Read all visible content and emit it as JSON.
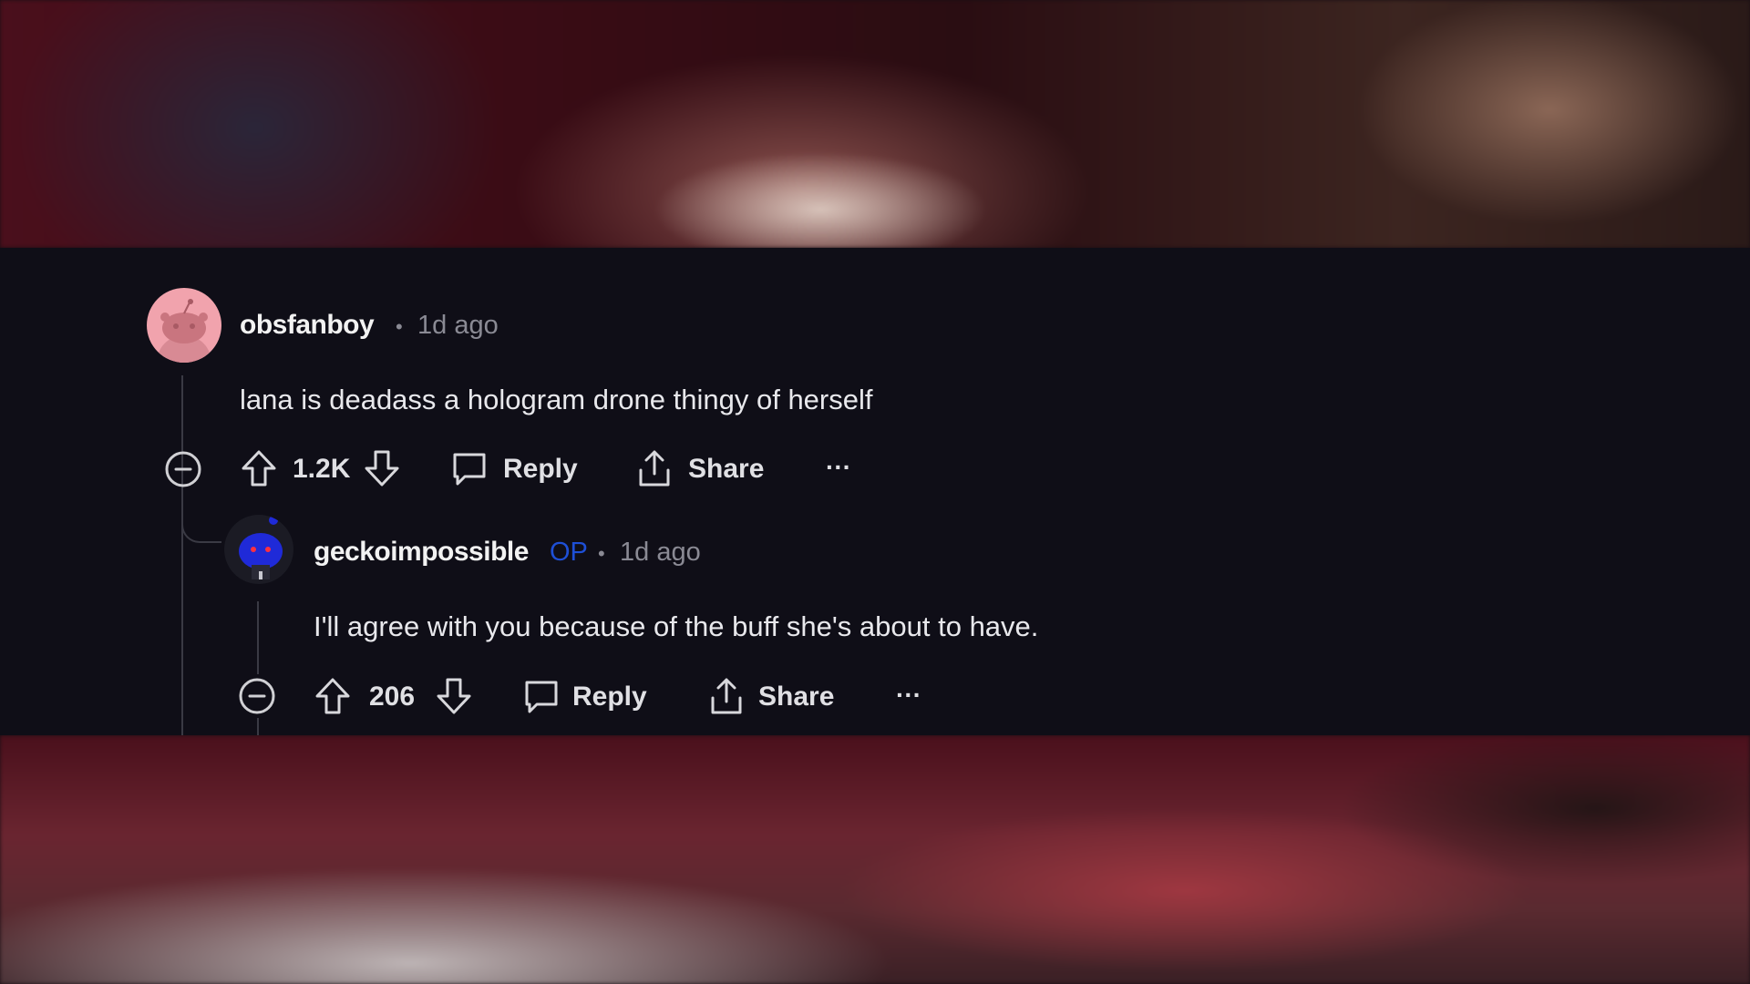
{
  "comments": [
    {
      "username": "obsfanboy",
      "separator": "•",
      "time": "1d ago",
      "body": "lana is deadass a hologram drone thingy of herself",
      "votes": "1.2K",
      "reply_label": "Reply",
      "share_label": "Share",
      "more_label": "···"
    },
    {
      "username": "geckoimpossible",
      "op_badge": "OP",
      "separator": "•",
      "time": "1d ago",
      "body": "I'll agree with you because of the buff she's about to have.",
      "votes": "206",
      "reply_label": "Reply",
      "share_label": "Share",
      "more_label": "···"
    }
  ],
  "colors": {
    "panel_bg": "#0f0e17",
    "avatar1_bg": "#f1a3ad",
    "op_badge": "#1e4fd6",
    "meta_text": "#8a8a94"
  }
}
